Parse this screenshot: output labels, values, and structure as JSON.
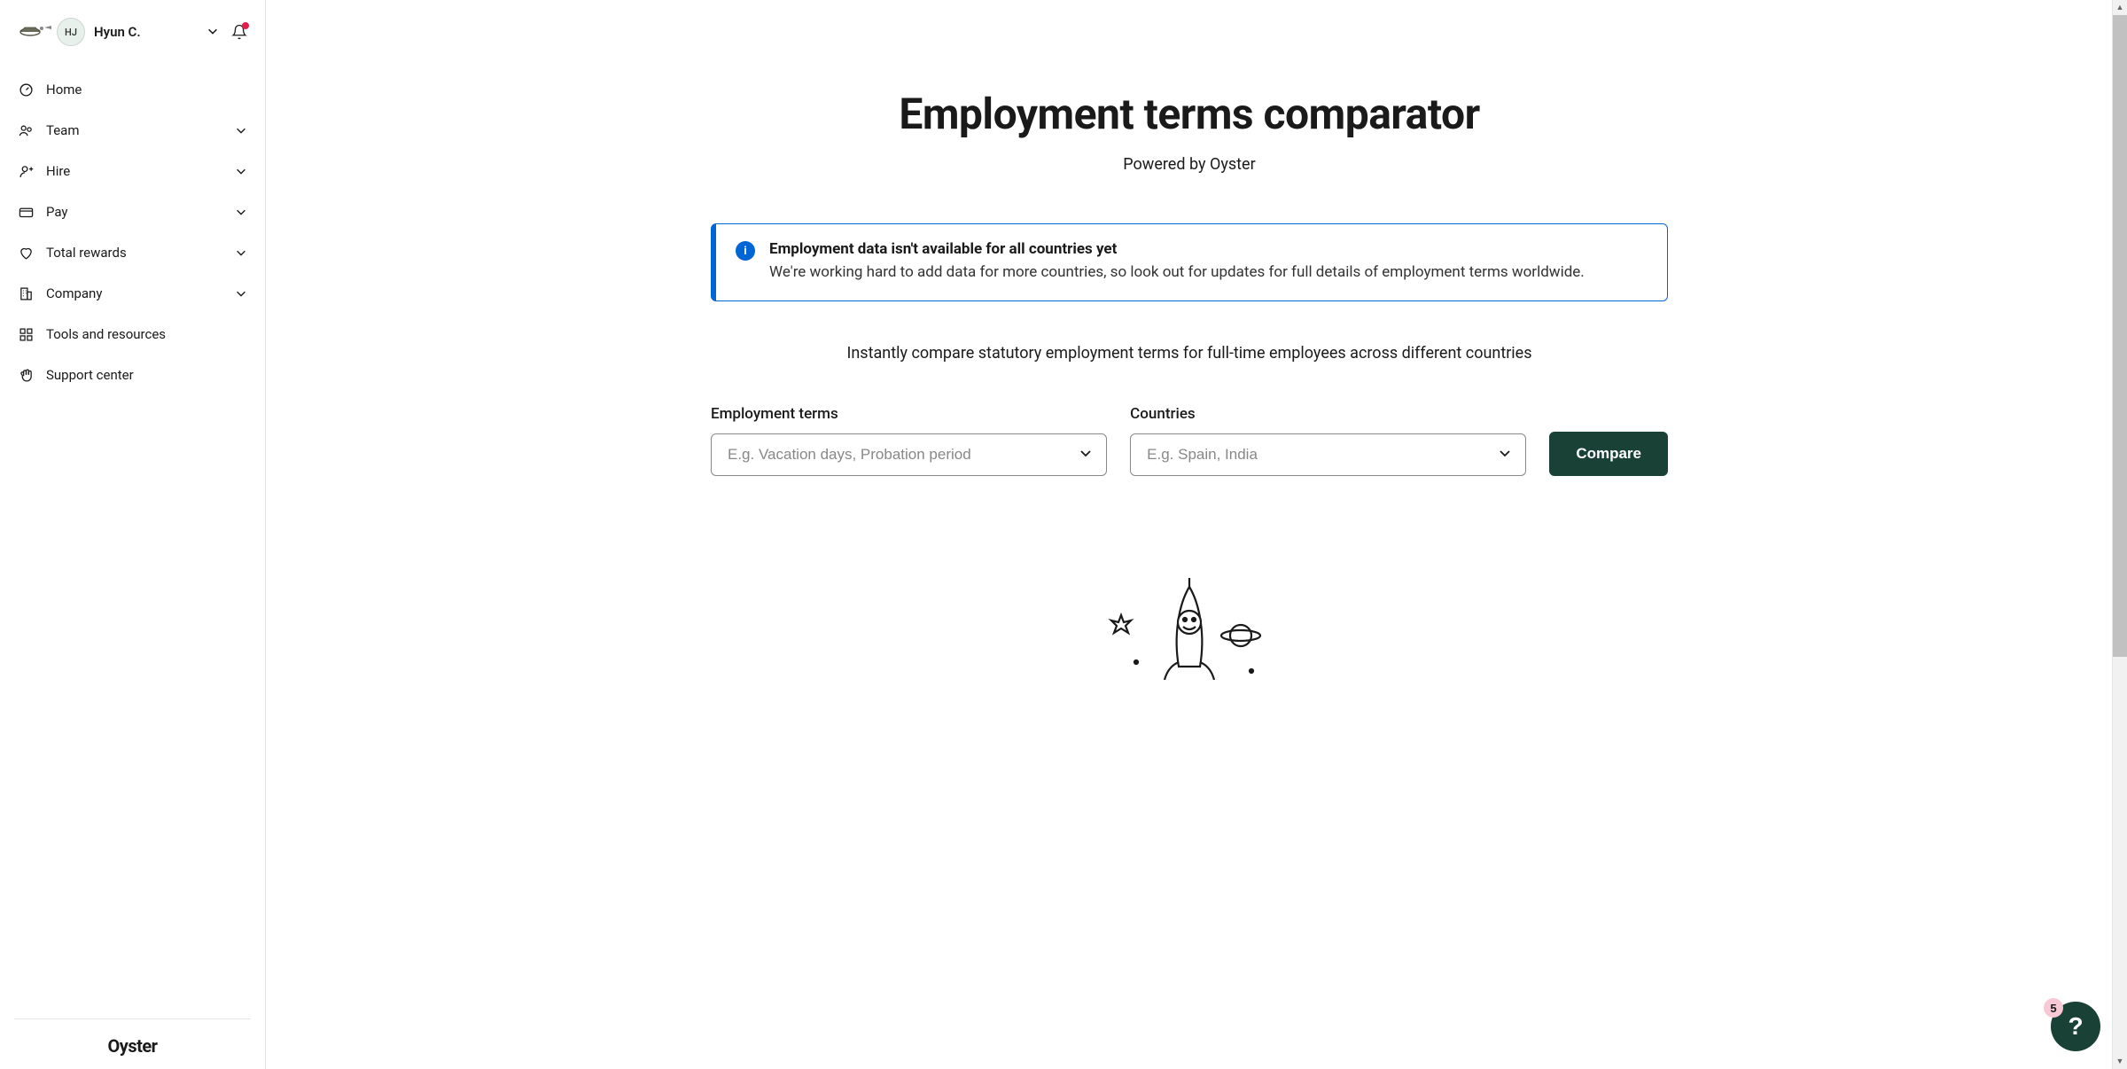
{
  "header": {
    "user_initials": "HJ",
    "user_name": "Hyun C.",
    "has_notification": true
  },
  "sidebar": {
    "items": [
      {
        "label": "Home",
        "icon": "home",
        "expandable": false
      },
      {
        "label": "Team",
        "icon": "team",
        "expandable": true
      },
      {
        "label": "Hire",
        "icon": "hire",
        "expandable": true
      },
      {
        "label": "Pay",
        "icon": "pay",
        "expandable": true
      },
      {
        "label": "Total rewards",
        "icon": "heart",
        "expandable": true
      },
      {
        "label": "Company",
        "icon": "building",
        "expandable": true
      },
      {
        "label": "Tools and resources",
        "icon": "grid",
        "expandable": false
      },
      {
        "label": "Support center",
        "icon": "hand",
        "expandable": false
      }
    ],
    "footer_brand": "Oyster"
  },
  "main": {
    "title": "Employment terms comparator",
    "subtitle": "Powered by Oyster",
    "info": {
      "title": "Employment data isn't available for all countries yet",
      "body": "We're working hard to add data for more countries, so look out for updates for full details of employment terms worldwide."
    },
    "description": "Instantly compare statutory employment terms for full-time employees across different countries",
    "fields": {
      "employment_terms": {
        "label": "Employment terms",
        "placeholder": "E.g. Vacation days, Probation period",
        "value": ""
      },
      "countries": {
        "label": "Countries",
        "placeholder": "E.g. Spain, India",
        "value": ""
      }
    },
    "compare_label": "Compare"
  },
  "help": {
    "badge_count": "5",
    "symbol": "?"
  },
  "colors": {
    "accent_blue": "#0066d6",
    "brand_green": "#1a4136",
    "badge_pink": "#f7c9d4",
    "notification_red": "#e11d48"
  }
}
